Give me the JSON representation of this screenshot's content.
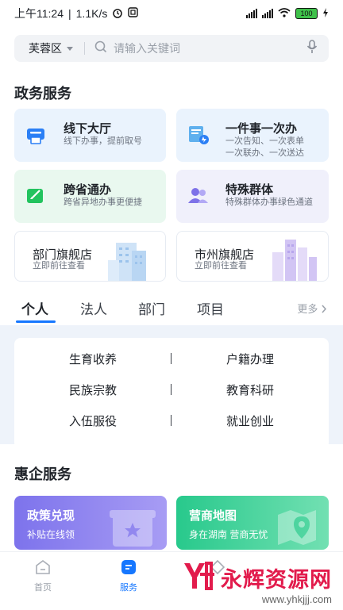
{
  "status_bar": {
    "time": "上午11:24",
    "speed": "1.1K/s",
    "battery": "100"
  },
  "search": {
    "region": "芙蓉区",
    "placeholder": "请输入关键词"
  },
  "gov": {
    "title": "政务服务",
    "cards": [
      {
        "title": "线下大厅",
        "sub": "线下办事，提前取号"
      },
      {
        "title": "一件事一次办",
        "sub1": "一次告知、一次表单",
        "sub2": "一次联办、一次送达"
      },
      {
        "title": "跨省通办",
        "sub": "跨省异地办事更便捷"
      },
      {
        "title": "特殊群体",
        "sub": "特殊群体办事绿色通道"
      },
      {
        "title": "部门旗舰店",
        "sub": "立即前往查看"
      },
      {
        "title": "市州旗舰店",
        "sub": "立即前往查看"
      }
    ]
  },
  "tabs": {
    "items": [
      "个人",
      "法人",
      "部门",
      "项目"
    ],
    "more": "更多"
  },
  "categories": [
    "生育收养",
    "户籍办理",
    "民族宗教",
    "教育科研",
    "入伍服役",
    "就业创业"
  ],
  "enterprise": {
    "title": "惠企服务",
    "cards": [
      {
        "title": "政策兑现",
        "sub": "补贴在线领"
      },
      {
        "title": "营商地图",
        "sub": "身在湖南 营商无忧"
      }
    ]
  },
  "nav": {
    "items": [
      "首页",
      "服务"
    ]
  },
  "watermark": {
    "text": "永辉资源网",
    "url": "www.yhkjjj.com"
  },
  "colors": {
    "accent": "#1677ff",
    "green_card": "#e9f8ef",
    "purple_card": "#f0f0fb"
  }
}
